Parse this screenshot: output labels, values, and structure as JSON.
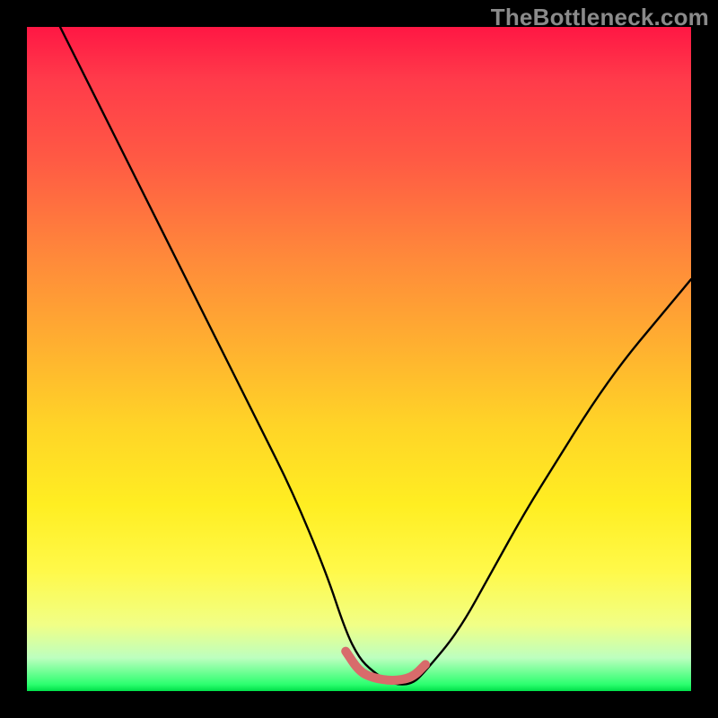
{
  "watermark": "TheBottleneck.com",
  "chart_data": {
    "type": "line",
    "title": "",
    "xlabel": "",
    "ylabel": "",
    "xlim": [
      0,
      100
    ],
    "ylim": [
      0,
      100
    ],
    "grid": false,
    "series": [
      {
        "name": "bottleneck-curve",
        "color": "#000000",
        "x": [
          5,
          10,
          15,
          20,
          25,
          30,
          35,
          40,
          45,
          48,
          50,
          52,
          55,
          58,
          60,
          65,
          70,
          75,
          80,
          85,
          90,
          95,
          100
        ],
        "y": [
          100,
          90,
          80,
          70,
          60,
          50,
          40,
          30,
          18,
          9,
          5,
          3,
          1,
          1,
          3,
          9,
          18,
          27,
          35,
          43,
          50,
          56,
          62
        ]
      },
      {
        "name": "optimal-zone-marker",
        "color": "#d86b6b",
        "x": [
          48,
          50,
          52,
          55,
          58,
          60
        ],
        "y": [
          6,
          3,
          2,
          1.5,
          2,
          4
        ]
      }
    ],
    "gradient_stops": [
      {
        "pos": 0,
        "color": "#ff1744"
      },
      {
        "pos": 50,
        "color": "#ffd427"
      },
      {
        "pos": 90,
        "color": "#f1ff86"
      },
      {
        "pos": 100,
        "color": "#00e04a"
      }
    ]
  }
}
